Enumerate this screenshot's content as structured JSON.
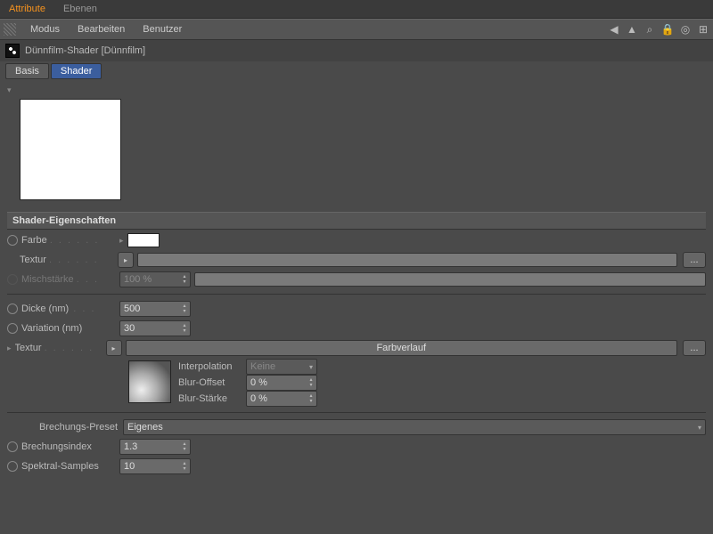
{
  "tabs": {
    "attribute": "Attribute",
    "ebenen": "Ebenen"
  },
  "menu": {
    "modus": "Modus",
    "bearbeiten": "Bearbeiten",
    "benutzer": "Benutzer"
  },
  "object_title": "Dünnfilm-Shader [Dünnfilm]",
  "subtabs": {
    "basis": "Basis",
    "shader": "Shader"
  },
  "section": "Shader-Eigenschaften",
  "rows": {
    "farbe": "Farbe",
    "textur": "Textur",
    "misch": "Mischstärke",
    "misch_val": "100 %",
    "dicke": "Dicke (nm)",
    "dicke_val": "500",
    "variation": "Variation (nm)",
    "variation_val": "30",
    "textur2": "Textur",
    "farbverlauf": "Farbverlauf",
    "interpolation": "Interpolation",
    "interp_val": "Keine",
    "blur_offset": "Blur-Offset",
    "blur_offset_val": "0 %",
    "blur_staerke": "Blur-Stärke",
    "blur_staerke_val": "0 %",
    "preset": "Brechungs-Preset",
    "preset_val": "Eigenes",
    "index": "Brechungsindex",
    "index_val": "1.3",
    "samples": "Spektral-Samples",
    "samples_val": "10"
  },
  "ellipsis": "..."
}
